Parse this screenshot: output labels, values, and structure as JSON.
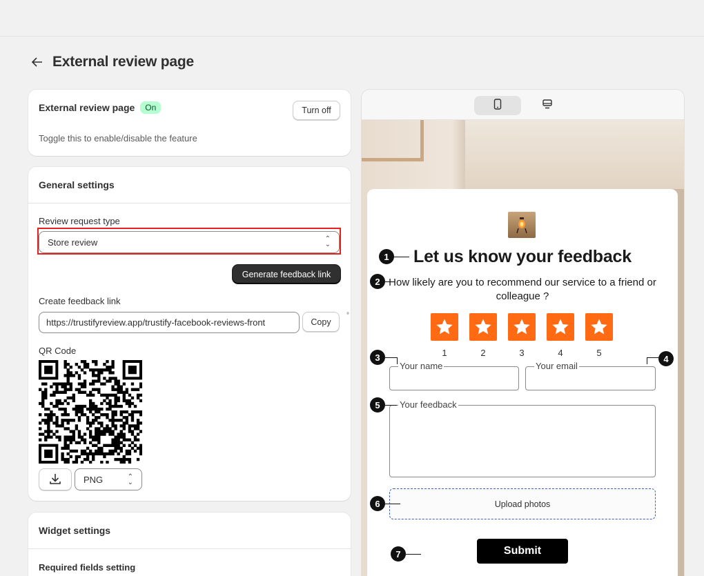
{
  "page": {
    "back_icon": "arrow-left-icon",
    "title": "External review page"
  },
  "feature_card": {
    "title": "External review page",
    "status_badge": "On",
    "toggle_button": "Turn off",
    "description": "Toggle this to enable/disable the feature"
  },
  "general": {
    "title": "General settings",
    "review_type_label": "Review request type",
    "review_type_value": "Store review",
    "generate_button": "Generate feedback link",
    "link_label": "Create feedback link",
    "link_value": "https://trustifyreview.app/trustify-facebook-reviews-front",
    "copy_button": "Copy",
    "qr_label": "QR Code",
    "format_value": "PNG",
    "extra_mark": "°"
  },
  "widget": {
    "title": "Widget settings",
    "required_fields_label": "Required fields setting"
  },
  "preview": {
    "device_mobile_icon": "mobile-icon",
    "device_desktop_icon": "desktop-icon",
    "form_title": "Let us know your feedback",
    "question": "How likely are you to recommend our service to a friend or colleague ?",
    "ratings": [
      "1",
      "2",
      "3",
      "4",
      "5"
    ],
    "star_color": "#ff6a13",
    "name_label": "Your name",
    "email_label": "Your email",
    "feedback_label": "Your feedback",
    "upload_label": "Upload photos",
    "submit_label": "Submit",
    "markers": [
      "1",
      "2",
      "3",
      "4",
      "5",
      "6",
      "7"
    ]
  },
  "colors": {
    "accent_red": "#e5211f",
    "primary_dark": "#303030",
    "badge_green": "#b4fed2"
  }
}
